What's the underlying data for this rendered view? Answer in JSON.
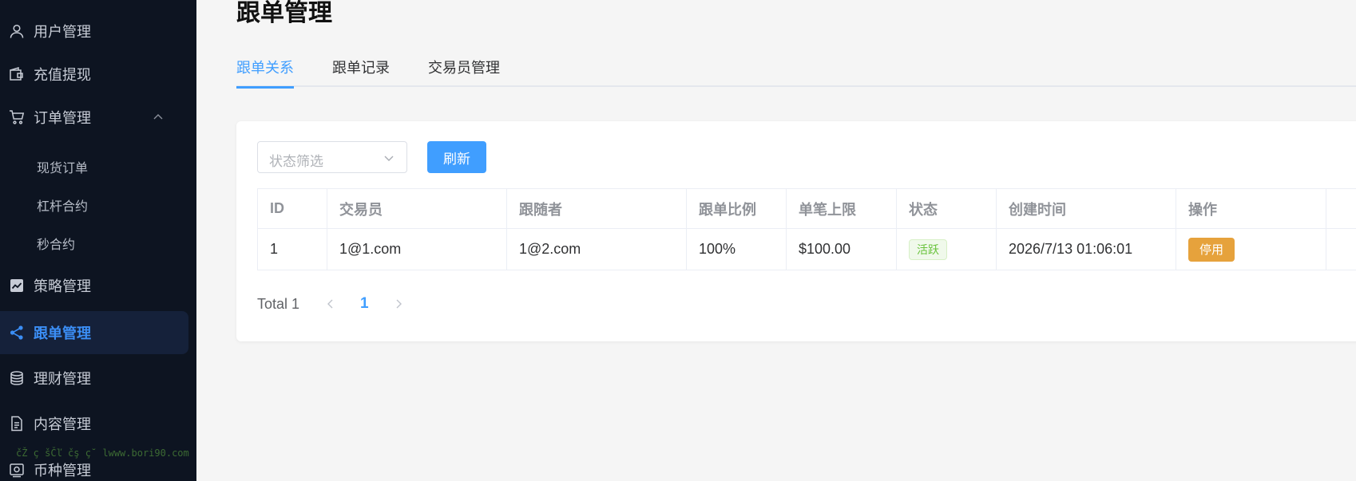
{
  "sidebar": {
    "items": [
      {
        "label": "用户管理",
        "icon": "user-icon"
      },
      {
        "label": "充值提现",
        "icon": "wallet-icon"
      },
      {
        "label": "订单管理",
        "icon": "cart-icon"
      },
      {
        "label": "策略管理",
        "icon": "trend-chart-icon"
      },
      {
        "label": "跟单管理",
        "icon": "share-icon"
      },
      {
        "label": "理财管理",
        "icon": "coins-icon"
      },
      {
        "label": "内容管理",
        "icon": "document-icon"
      },
      {
        "label": "币种管理",
        "icon": "coin-list-icon"
      }
    ],
    "order_submenu": [
      "现货订单",
      "杠杆合约",
      "秒合约"
    ],
    "active_item": "跟单管理",
    "watermark": "čŽ ç šČľ čş ç˘ lwww.bori90.com"
  },
  "page": {
    "title": "跟单管理",
    "tabs": [
      "跟单关系",
      "跟单记录",
      "交易员管理"
    ],
    "active_tab": "跟单关系"
  },
  "filter": {
    "status_placeholder": "状态筛选",
    "refresh_label": "刷新"
  },
  "table": {
    "columns": [
      "ID",
      "交易员",
      "跟随者",
      "跟单比例",
      "单笔上限",
      "状态",
      "创建时间",
      "操作"
    ],
    "rows": [
      {
        "id": "1",
        "trader": "1@1.com",
        "follower": "1@2.com",
        "ratio": "100%",
        "limit": "$100.00",
        "status": "活跃",
        "created": "2026/7/13 01:06:01",
        "action": "停用"
      }
    ]
  },
  "pagination": {
    "total": "Total 1",
    "current_page": "1"
  },
  "colors": {
    "sidebar_bg": "#0d1421",
    "accent": "#409eff",
    "warning": "#e6a23c",
    "success": "#67c23a"
  }
}
